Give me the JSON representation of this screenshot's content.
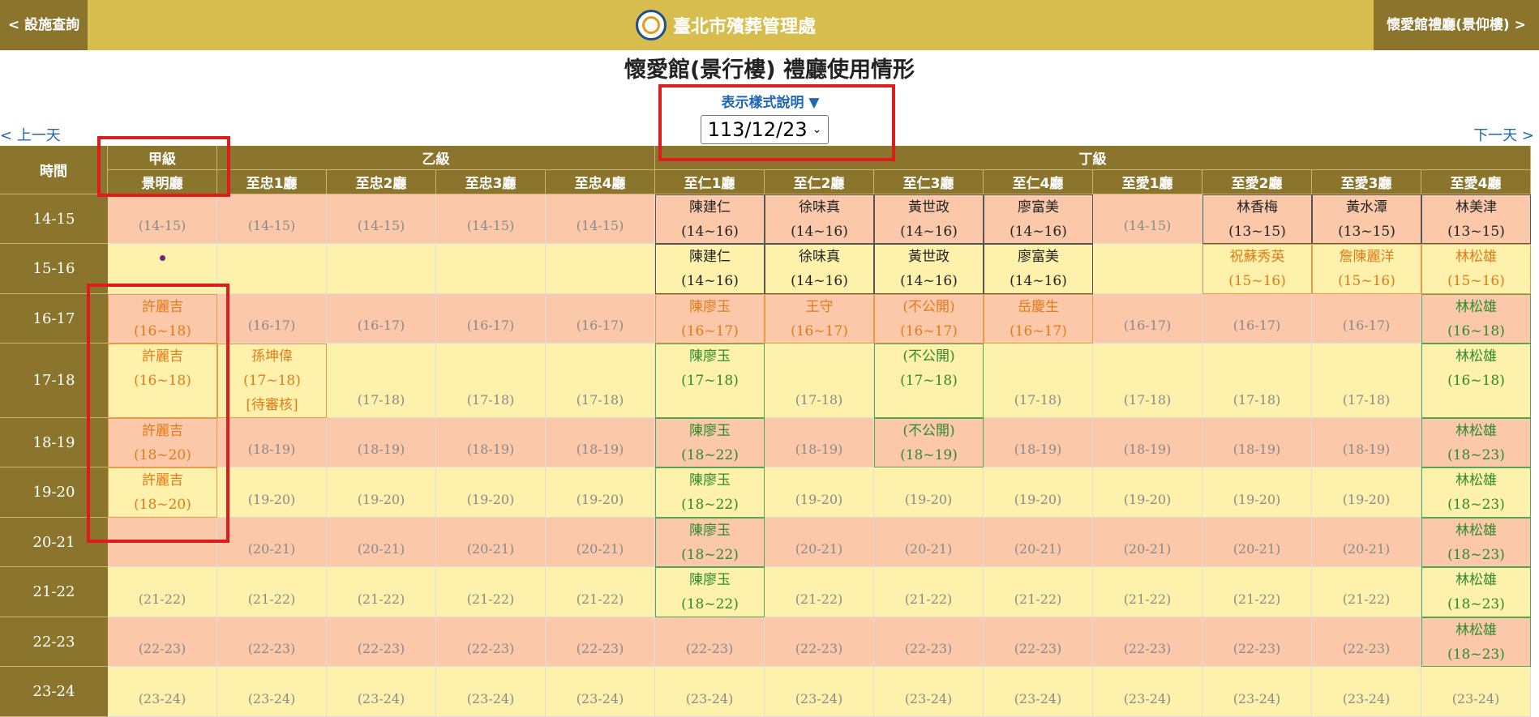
{
  "nav": {
    "back_label": "< 設施查詢",
    "brand_name": "臺北市殯葬管理處",
    "hall_label": "懷愛館禮廳(景仰樓) >"
  },
  "page": {
    "title": "懷愛館(景行樓) 禮廳使用情形",
    "legend_link": "表示樣式說明 ▼",
    "date_value": "113/12/23",
    "prev_day": "< 上一天",
    "next_day": "下一天 >"
  },
  "table": {
    "time_header": "時間",
    "groups": [
      "甲級",
      "乙級",
      "丁級"
    ],
    "halls": [
      "景明廳",
      "至忠1廳",
      "至忠2廳",
      "至忠3廳",
      "至忠4廳",
      "至仁1廳",
      "至仁2廳",
      "至仁3廳",
      "至仁4廳",
      "至愛1廳",
      "至愛2廳",
      "至愛3廳",
      "至愛4廳"
    ],
    "times": [
      "14-15",
      "15-16",
      "16-17",
      "17-18",
      "18-19",
      "19-20",
      "20-21",
      "21-22",
      "22-23",
      "23-24"
    ],
    "free_labels": [
      "(14-15)",
      "(15-16)",
      "(16-17)",
      "(17-18)",
      "(18-19)",
      "(19-20)",
      "(20-21)",
      "(21-22)",
      "(22-23)",
      "(23-24)"
    ],
    "bookings": [
      {
        "row": 0,
        "col": 5,
        "name": "陳建仁",
        "range": "(14~16)",
        "style": "black"
      },
      {
        "row": 0,
        "col": 6,
        "name": "徐味真",
        "range": "(14~16)",
        "style": "black"
      },
      {
        "row": 0,
        "col": 7,
        "name": "黃世政",
        "range": "(14~16)",
        "style": "black"
      },
      {
        "row": 0,
        "col": 8,
        "name": "廖富美",
        "range": "(14~16)",
        "style": "black"
      },
      {
        "row": 0,
        "col": 10,
        "name": "林香梅",
        "range": "(13~15)",
        "style": "black"
      },
      {
        "row": 0,
        "col": 11,
        "name": "黃水潭",
        "range": "(13~15)",
        "style": "black"
      },
      {
        "row": 0,
        "col": 12,
        "name": "林美津",
        "range": "(13~15)",
        "style": "black"
      },
      {
        "row": 1,
        "col": 5,
        "name": "陳建仁",
        "range": "(14~16)",
        "style": "black"
      },
      {
        "row": 1,
        "col": 6,
        "name": "徐味真",
        "range": "(14~16)",
        "style": "black"
      },
      {
        "row": 1,
        "col": 7,
        "name": "黃世政",
        "range": "(14~16)",
        "style": "black"
      },
      {
        "row": 1,
        "col": 8,
        "name": "廖富美",
        "range": "(14~16)",
        "style": "black"
      },
      {
        "row": 1,
        "col": 10,
        "name": "祝蘇秀英",
        "range": "(15~16)",
        "style": "orange"
      },
      {
        "row": 1,
        "col": 11,
        "name": "詹陳麗洋",
        "range": "(15~16)",
        "style": "orange"
      },
      {
        "row": 1,
        "col": 12,
        "name": "林松雄",
        "range": "(15~16)",
        "style": "orange"
      },
      {
        "row": 2,
        "col": 0,
        "name": "許麗吉",
        "range": "(16~18)",
        "style": "orange"
      },
      {
        "row": 2,
        "col": 5,
        "name": "陳廖玉",
        "range": "(16~17)",
        "style": "orange"
      },
      {
        "row": 2,
        "col": 6,
        "name": "王守",
        "range": "(16~17)",
        "style": "orange"
      },
      {
        "row": 2,
        "col": 7,
        "name": "(不公開)",
        "range": "(16~17)",
        "style": "orange"
      },
      {
        "row": 2,
        "col": 8,
        "name": "岳慶生",
        "range": "(16~17)",
        "style": "orange"
      },
      {
        "row": 2,
        "col": 12,
        "name": "林松雄",
        "range": "(16~18)",
        "style": "green"
      },
      {
        "row": 3,
        "col": 0,
        "name": "許麗吉",
        "range": "(16~18)",
        "style": "orange"
      },
      {
        "row": 3,
        "col": 1,
        "name": "孫坤偉",
        "range": "(17~18)",
        "note": "[待審核]",
        "style": "orange"
      },
      {
        "row": 3,
        "col": 5,
        "name": "陳廖玉",
        "range": "(17~18)",
        "style": "green"
      },
      {
        "row": 3,
        "col": 7,
        "name": "(不公開)",
        "range": "(17~18)",
        "style": "green"
      },
      {
        "row": 3,
        "col": 12,
        "name": "林松雄",
        "range": "(16~18)",
        "style": "green"
      },
      {
        "row": 4,
        "col": 0,
        "name": "許麗吉",
        "range": "(18~20)",
        "style": "orange"
      },
      {
        "row": 4,
        "col": 5,
        "name": "陳廖玉",
        "range": "(18~22)",
        "style": "green"
      },
      {
        "row": 4,
        "col": 7,
        "name": "(不公開)",
        "range": "(18~19)",
        "style": "green"
      },
      {
        "row": 4,
        "col": 12,
        "name": "林松雄",
        "range": "(18~23)",
        "style": "green"
      },
      {
        "row": 5,
        "col": 0,
        "name": "許麗吉",
        "range": "(18~20)",
        "style": "orange"
      },
      {
        "row": 5,
        "col": 5,
        "name": "陳廖玉",
        "range": "(18~22)",
        "style": "green"
      },
      {
        "row": 5,
        "col": 12,
        "name": "林松雄",
        "range": "(18~23)",
        "style": "green"
      },
      {
        "row": 6,
        "col": 5,
        "name": "陳廖玉",
        "range": "(18~22)",
        "style": "green"
      },
      {
        "row": 6,
        "col": 12,
        "name": "林松雄",
        "range": "(18~23)",
        "style": "green"
      },
      {
        "row": 7,
        "col": 5,
        "name": "陳廖玉",
        "range": "(18~22)",
        "style": "green"
      },
      {
        "row": 7,
        "col": 12,
        "name": "林松雄",
        "range": "(18~23)",
        "style": "green"
      },
      {
        "row": 8,
        "col": 12,
        "name": "林松雄",
        "range": "(18~23)",
        "style": "green"
      }
    ],
    "blank_cells": [
      [
        1,
        0,
        "dot"
      ],
      [
        1,
        1
      ],
      [
        1,
        2
      ],
      [
        1,
        3
      ],
      [
        1,
        4
      ],
      [
        1,
        9
      ],
      [
        6,
        0
      ]
    ],
    "row_colors": [
      "salmon",
      "yellow",
      "salmon",
      "yellow",
      "salmon",
      "yellow",
      "salmon",
      "yellow",
      "salmon",
      "yellow"
    ]
  },
  "colors": {
    "header_bg": "#8b752d",
    "topbar_bg": "#d7bd4d",
    "reserved_black": "#222222",
    "reserved_orange": "#e07b1a",
    "reserved_green": "#2d8a2d",
    "highlight_box": "#e01b1b"
  }
}
